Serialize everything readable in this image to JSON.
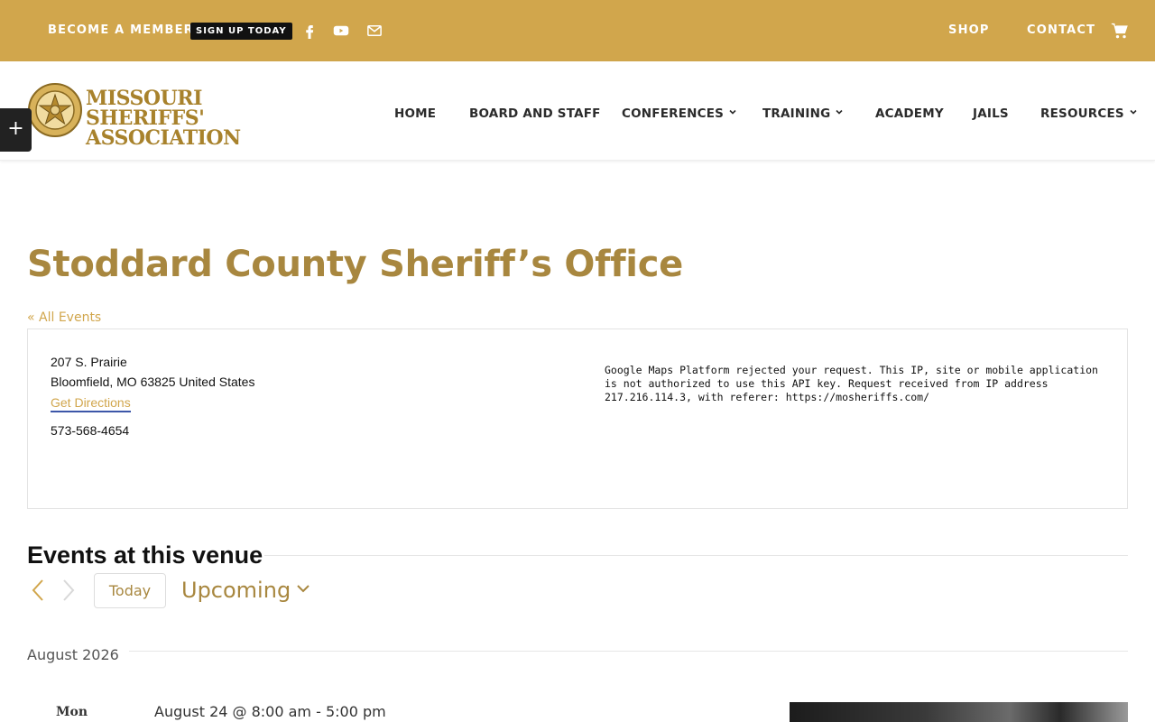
{
  "topbar": {
    "become_member": "BECOME A MEMBER!",
    "signup": "SIGN UP TODAY",
    "links": [
      "SHOP",
      "CONTACT"
    ],
    "social_icons": [
      "facebook-icon",
      "youtube-icon",
      "mail-icon"
    ],
    "bg_color": "#d1a64c"
  },
  "header": {
    "logo_line1": "MISSOURI SHERIFFS'",
    "logo_line2": "ASSOCIATION",
    "nav": [
      {
        "label": "HOME"
      },
      {
        "label": "BOARD AND STAFF"
      },
      {
        "label": "CONFERENCES",
        "dropdown": true
      },
      {
        "label": "TRAINING",
        "dropdown": true
      },
      {
        "label": "ACADEMY"
      },
      {
        "label": "JAILS"
      },
      {
        "label": "RESOURCES",
        "dropdown": true
      }
    ],
    "side_toggle": "+"
  },
  "page": {
    "title": "Stoddard County Sheriff’s Office",
    "back_link": "« All Events"
  },
  "venue": {
    "street": "207 S. Prairie",
    "city_line": "Bloomfield, MO 63825 United States",
    "directions": "Get Directions",
    "phone": "573-568-4654",
    "map_error": "Google Maps Platform rejected your request. This IP, site or mobile application is not authorized to use this API key. Request received from IP address 217.216.114.3, with referer: https://mosheriffs.com/"
  },
  "events": {
    "heading": "Events at this venue",
    "today": "Today",
    "view": "Upcoming",
    "month": "August 2026",
    "items": [
      {
        "day": "Mon",
        "time": "August 24 @ 8:00 am - 5:00 pm"
      }
    ]
  },
  "colors": {
    "accent": "#d1a64c",
    "title": "#a8873f"
  }
}
